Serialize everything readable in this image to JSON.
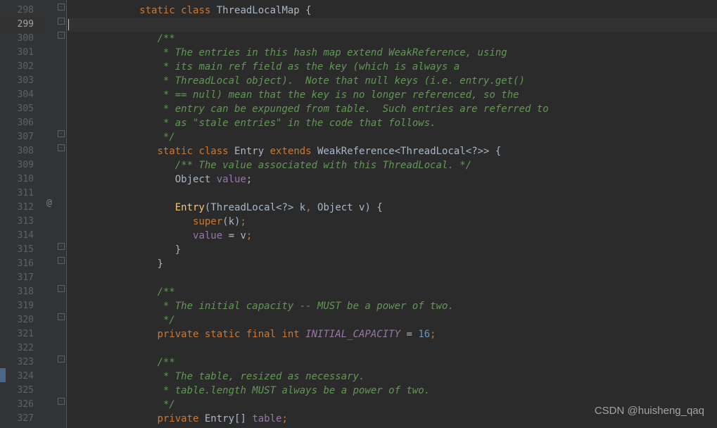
{
  "startLine": 298,
  "activeLine": 299,
  "atMarkerLine": 312,
  "watermark": "CSDN @huisheng_qaq",
  "foldLines": [
    298,
    299,
    300,
    307,
    308,
    315,
    316,
    318,
    320,
    323,
    326
  ],
  "lines": [
    {
      "n": 298,
      "segs": [
        {
          "t": "            ",
          "c": ""
        },
        {
          "t": "static class ",
          "c": "kw"
        },
        {
          "t": "ThreadLocalMap",
          "c": "classname"
        },
        {
          "t": " {",
          "c": "punct"
        }
      ]
    },
    {
      "n": 299,
      "segs": []
    },
    {
      "n": 300,
      "segs": [
        {
          "t": "               ",
          "c": ""
        },
        {
          "t": "/**",
          "c": "comment"
        }
      ]
    },
    {
      "n": 301,
      "segs": [
        {
          "t": "               ",
          "c": ""
        },
        {
          "t": " * The entries in this hash map extend WeakReference, using",
          "c": "comment"
        }
      ]
    },
    {
      "n": 302,
      "segs": [
        {
          "t": "               ",
          "c": ""
        },
        {
          "t": " * its main ref field as the key (which is always a",
          "c": "comment"
        }
      ]
    },
    {
      "n": 303,
      "segs": [
        {
          "t": "               ",
          "c": ""
        },
        {
          "t": " * ThreadLocal object).  Note that null keys (i.e. entry.get()",
          "c": "comment"
        }
      ]
    },
    {
      "n": 304,
      "segs": [
        {
          "t": "               ",
          "c": ""
        },
        {
          "t": " * == null) mean that the key is no longer referenced, so the",
          "c": "comment"
        }
      ]
    },
    {
      "n": 305,
      "segs": [
        {
          "t": "               ",
          "c": ""
        },
        {
          "t": " * entry can be expunged from table.  Such entries are referred to",
          "c": "comment"
        }
      ]
    },
    {
      "n": 306,
      "segs": [
        {
          "t": "               ",
          "c": ""
        },
        {
          "t": " * as \"stale entries\" in the code that follows.",
          "c": "comment"
        }
      ]
    },
    {
      "n": 307,
      "segs": [
        {
          "t": "               ",
          "c": ""
        },
        {
          "t": " */",
          "c": "comment"
        }
      ]
    },
    {
      "n": 308,
      "segs": [
        {
          "t": "               ",
          "c": ""
        },
        {
          "t": "static class ",
          "c": "kw"
        },
        {
          "t": "Entry",
          "c": "classname"
        },
        {
          "t": " ",
          "c": ""
        },
        {
          "t": "extends ",
          "c": "kw"
        },
        {
          "t": "WeakReference<ThreadLocal<?>>",
          "c": "classname"
        },
        {
          "t": " {",
          "c": "punct"
        }
      ]
    },
    {
      "n": 309,
      "segs": [
        {
          "t": "                  ",
          "c": ""
        },
        {
          "t": "/** The value associated with this ThreadLocal. */",
          "c": "comment"
        }
      ]
    },
    {
      "n": 310,
      "segs": [
        {
          "t": "                  ",
          "c": ""
        },
        {
          "t": "Object",
          "c": "classname"
        },
        {
          "t": " ",
          "c": ""
        },
        {
          "t": "value",
          "c": "field"
        },
        {
          "t": ";",
          "c": "punct"
        }
      ]
    },
    {
      "n": 311,
      "segs": []
    },
    {
      "n": 312,
      "segs": [
        {
          "t": "                  ",
          "c": ""
        },
        {
          "t": "Entry",
          "c": "method"
        },
        {
          "t": "(ThreadLocal<?>",
          "c": "punct"
        },
        {
          "t": " k",
          "c": ""
        },
        {
          "t": ",",
          "c": "kw"
        },
        {
          "t": " Object v) {",
          "c": "punct"
        }
      ]
    },
    {
      "n": 313,
      "segs": [
        {
          "t": "                     ",
          "c": ""
        },
        {
          "t": "super",
          "c": "kw"
        },
        {
          "t": "(k)",
          "c": "punct"
        },
        {
          "t": ";",
          "c": "kw"
        }
      ]
    },
    {
      "n": 314,
      "segs": [
        {
          "t": "                     ",
          "c": ""
        },
        {
          "t": "value",
          "c": "field"
        },
        {
          "t": " = v",
          "c": "punct"
        },
        {
          "t": ";",
          "c": "kw"
        }
      ]
    },
    {
      "n": 315,
      "segs": [
        {
          "t": "                  ",
          "c": ""
        },
        {
          "t": "}",
          "c": "punct"
        }
      ]
    },
    {
      "n": 316,
      "segs": [
        {
          "t": "               ",
          "c": ""
        },
        {
          "t": "}",
          "c": "punct"
        }
      ]
    },
    {
      "n": 317,
      "segs": []
    },
    {
      "n": 318,
      "segs": [
        {
          "t": "               ",
          "c": ""
        },
        {
          "t": "/**",
          "c": "comment"
        }
      ]
    },
    {
      "n": 319,
      "segs": [
        {
          "t": "               ",
          "c": ""
        },
        {
          "t": " * The initial capacity -- MUST be a power of two.",
          "c": "comment"
        }
      ]
    },
    {
      "n": 320,
      "segs": [
        {
          "t": "               ",
          "c": ""
        },
        {
          "t": " */",
          "c": "comment"
        }
      ]
    },
    {
      "n": 321,
      "segs": [
        {
          "t": "               ",
          "c": ""
        },
        {
          "t": "private static final int ",
          "c": "kw"
        },
        {
          "t": "INITIAL_CAPACITY",
          "c": "static-field"
        },
        {
          "t": " = ",
          "c": "punct"
        },
        {
          "t": "16",
          "c": "number"
        },
        {
          "t": ";",
          "c": "kw"
        }
      ]
    },
    {
      "n": 322,
      "segs": []
    },
    {
      "n": 323,
      "segs": [
        {
          "t": "               ",
          "c": ""
        },
        {
          "t": "/**",
          "c": "comment"
        }
      ]
    },
    {
      "n": 324,
      "segs": [
        {
          "t": "               ",
          "c": ""
        },
        {
          "t": " * The table, resized as necessary.",
          "c": "comment"
        }
      ]
    },
    {
      "n": 325,
      "segs": [
        {
          "t": "               ",
          "c": ""
        },
        {
          "t": " * table.length MUST always be a power of two.",
          "c": "comment"
        }
      ]
    },
    {
      "n": 326,
      "segs": [
        {
          "t": "               ",
          "c": ""
        },
        {
          "t": " */",
          "c": "comment"
        }
      ]
    },
    {
      "n": 327,
      "segs": [
        {
          "t": "               ",
          "c": ""
        },
        {
          "t": "private ",
          "c": "kw"
        },
        {
          "t": "Entry[]",
          "c": "classname"
        },
        {
          "t": " ",
          "c": ""
        },
        {
          "t": "table",
          "c": "field"
        },
        {
          "t": ";",
          "c": "kw"
        }
      ]
    }
  ]
}
